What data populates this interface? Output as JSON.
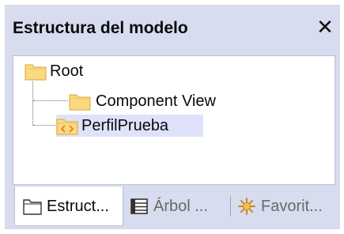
{
  "panel": {
    "title": "Estructura del modelo",
    "close_symbol": "✕"
  },
  "tree": {
    "nodes": [
      {
        "label": "Root",
        "icon": "folder-icon"
      },
      {
        "label": "Component View",
        "icon": "folder-icon"
      },
      {
        "label": "PerfilPrueba",
        "icon": "profile-folder-icon",
        "selected": true
      }
    ]
  },
  "tabs": [
    {
      "label": "Estruct...",
      "icon": "folder-outline-icon",
      "active": true
    },
    {
      "label": "Árbol ...",
      "icon": "hierarchy-icon",
      "active": false
    },
    {
      "label": "Favorit...",
      "icon": "star-burst-icon",
      "active": false
    }
  ],
  "colors": {
    "frame": "#d7dcee",
    "selection": "#e0e2fb",
    "folder_fill": "#fbd980",
    "folder_stroke": "#d9a53a"
  }
}
